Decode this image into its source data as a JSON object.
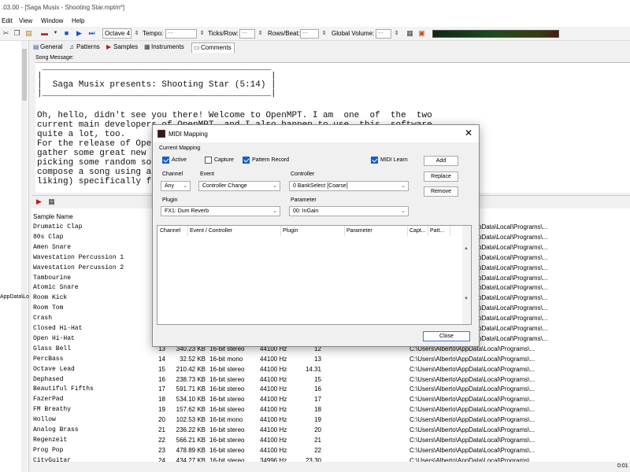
{
  "window": {
    "title": ".03.00 - [Saga Musix - Shooting Star.mptm*]"
  },
  "menu": [
    "Edit",
    "View",
    "Window",
    "Help"
  ],
  "toolbar": {
    "octave": "Octave 4",
    "tempo_label": "Tempo:",
    "ticks_label": "Ticks/Row:",
    "rows_label": "Rows/Beat:",
    "volume_label": "Global Volume:",
    "field_placeholder": "---"
  },
  "tabs": [
    "General",
    "Patterns",
    "Samples",
    "Instruments",
    "Comments"
  ],
  "left_pane": {
    "path_fragment": "AppData\\Lo"
  },
  "comments": {
    "label": "Song Message:",
    "lines": [
      " ____________________________________________",
      "|                                            |",
      "|  Saga Musix presents: Shooting Star (5:14) |",
      "|____________________________________________|",
      "",
      "Oh, hello, didn't see you there! Welcome to OpenMPT. I am  one  of  the  two",
      "current main developers of OpenMPT, and I also happen to use  this  software",
      "quite a lot, too.",
      "For the release of OpenMPT 1.30, I have given in to the request to",
      "gather some great new example songs in OpenMPT's installer. Instead of",
      "picking some random songs from the archives, I have decided to",
      "compose a song using a couple of features that I found to my",
      "liking) specifically for this release."
    ]
  },
  "samples": {
    "header": "Sample Name",
    "rows": [
      {
        "name": "Drumatic Clap",
        "num": "",
        "size": "",
        "type": "",
        "rate": "",
        "note": "",
        "path": ""
      },
      {
        "name": "80s Clap",
        "num": "",
        "size": "",
        "type": "",
        "rate": "",
        "note": "",
        "path": ""
      },
      {
        "name": "Amen Snare",
        "num": "",
        "size": "",
        "type": "",
        "rate": "",
        "note": "",
        "path": ""
      },
      {
        "name": "Wavestation Percussion 1",
        "num": "",
        "size": "",
        "type": "",
        "rate": "",
        "note": "",
        "path": ""
      },
      {
        "name": "Wavestation Percussion 2",
        "num": "",
        "size": "",
        "type": "",
        "rate": "",
        "note": "",
        "path": ""
      },
      {
        "name": "Tambourine",
        "num": "",
        "size": "",
        "type": "",
        "rate": "",
        "note": "",
        "path": ""
      },
      {
        "name": "Atomic Snare",
        "num": "",
        "size": "",
        "type": "",
        "rate": "",
        "note": "",
        "path": ""
      },
      {
        "name": "Room Kick",
        "num": "",
        "size": "",
        "type": "",
        "rate": "",
        "note": "",
        "path": ""
      },
      {
        "name": "Room Tom",
        "num": "",
        "size": "",
        "type": "",
        "rate": "",
        "note": "",
        "path": ""
      },
      {
        "name": "Crash",
        "num": "",
        "size": "",
        "type": "",
        "rate": "",
        "note": "",
        "path": ""
      },
      {
        "name": "Closed Hi-Hat",
        "num": "",
        "size": "",
        "type": "",
        "rate": "",
        "note": "",
        "path": ""
      },
      {
        "name": "Open Hi-Hat",
        "num": "",
        "size": "",
        "type": "",
        "rate": "",
        "note": "",
        "path": ""
      },
      {
        "name": "Glass Bell",
        "num": "13",
        "size": "340.23 KB",
        "type": "16-bit stereo",
        "rate": "44100 Hz",
        "note": "12",
        "path": "C:\\Users\\Alberto\\AppData\\Local\\Programs\\..."
      },
      {
        "name": "PercBass",
        "num": "14",
        "size": "32.52 KB",
        "type": "16-bit mono",
        "rate": "44100 Hz",
        "note": "13",
        "path": "C:\\Users\\Alberto\\AppData\\Local\\Programs\\..."
      },
      {
        "name": "Octave Lead",
        "num": "15",
        "size": "210.42 KB",
        "type": "16-bit stereo",
        "rate": "44100 Hz",
        "note": "14.31",
        "path": "C:\\Users\\Alberto\\AppData\\Local\\Programs\\..."
      },
      {
        "name": "Dephased",
        "num": "16",
        "size": "238.73 KB",
        "type": "16-bit stereo",
        "rate": "44100 Hz",
        "note": "15",
        "path": "C:\\Users\\Alberto\\AppData\\Local\\Programs\\..."
      },
      {
        "name": "Beautiful Fifths",
        "num": "17",
        "size": "591.71 KB",
        "type": "16-bit stereo",
        "rate": "44100 Hz",
        "note": "16",
        "path": "C:\\Users\\Alberto\\AppData\\Local\\Programs\\..."
      },
      {
        "name": "FazerPad",
        "num": "18",
        "size": "534.10 KB",
        "type": "16-bit stereo",
        "rate": "44100 Hz",
        "note": "17",
        "path": "C:\\Users\\Alberto\\AppData\\Local\\Programs\\..."
      },
      {
        "name": "FM Breathy",
        "num": "19",
        "size": "157.62 KB",
        "type": "16-bit stereo",
        "rate": "44100 Hz",
        "note": "18",
        "path": "C:\\Users\\Alberto\\AppData\\Local\\Programs\\..."
      },
      {
        "name": "Hollow",
        "num": "20",
        "size": "102.53 KB",
        "type": "16-bit mono",
        "rate": "44100 Hz",
        "note": "19",
        "path": "C:\\Users\\Alberto\\AppData\\Local\\Programs\\..."
      },
      {
        "name": "Analog Brass",
        "num": "21",
        "size": "236.22 KB",
        "type": "16-bit stereo",
        "rate": "44100 Hz",
        "note": "20",
        "path": "C:\\Users\\Alberto\\AppData\\Local\\Programs\\..."
      },
      {
        "name": "Regenzeit",
        "num": "22",
        "size": "566.21 KB",
        "type": "16-bit stereo",
        "rate": "44100 Hz",
        "note": "21",
        "path": "C:\\Users\\Alberto\\AppData\\Local\\Programs\\..."
      },
      {
        "name": "Prog Pop",
        "num": "23",
        "size": "478.89 KB",
        "type": "16-bit stereo",
        "rate": "44100 Hz",
        "note": "22",
        "path": "C:\\Users\\Alberto\\AppData\\Local\\Programs\\..."
      },
      {
        "name": "CityGuitar",
        "num": "24",
        "size": "434.27 KB",
        "type": "16-bit stereo",
        "rate": "34996 Hz",
        "note": "23.30",
        "path": "C:\\Users\\Alberto\\AppData\\Local\\Programs\\..."
      }
    ],
    "right_paths": [
      "pData\\Local\\Programs\\...",
      "pData\\Local\\Programs\\...",
      "pData\\Local\\Programs\\...",
      "pData\\Local\\Programs\\...",
      "pData\\Local\\Programs\\...",
      "pData\\Local\\Programs\\...",
      "pData\\Local\\Programs\\...",
      "pData\\Local\\Programs\\...",
      "pData\\Local\\Programs\\...",
      "pData\\Local\\Programs\\...",
      "pData\\Local\\Programs\\...",
      "pData\\Local\\Programs\\..."
    ]
  },
  "status": {
    "time": "0:01"
  },
  "dialog": {
    "title": "MIDI Mapping",
    "close_glyph": "✕",
    "current_mapping_label": "Current Mapping",
    "active_label": "Active",
    "capture_label": "Capture",
    "pattern_record_label": "Pattern Record",
    "midi_learn_label": "MIDI Learn",
    "channel_label": "Channel",
    "channel_value": "Any",
    "event_label": "Event",
    "event_value": "Controller Change",
    "controller_label": "Controller",
    "controller_value": "0 BankSelect [Coarse]",
    "plugin_label": "Plugin",
    "plugin_value": "FX1: Dum Reverb",
    "parameter_label": "Parameter",
    "parameter_value": "00: InGain",
    "add_label": "Add",
    "replace_label": "Replace",
    "remove_label": "Remove",
    "close_label": "Close",
    "list_headers": [
      "Channel",
      "Event / Controller",
      "Plugin",
      "Parameter",
      "Capt...",
      "Patt..."
    ]
  }
}
